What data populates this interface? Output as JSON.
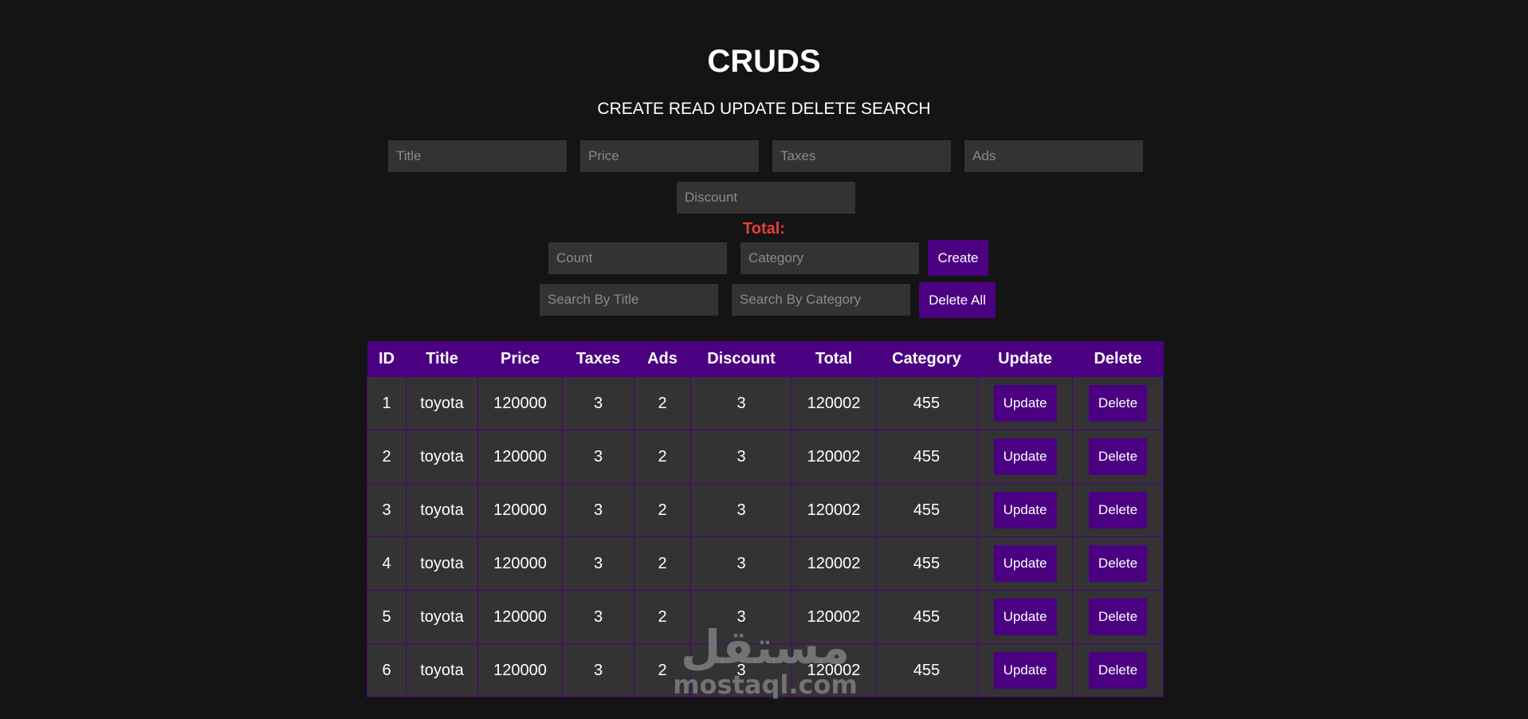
{
  "header": {
    "title": "CRUDS",
    "subtitle": "CREATE READ UPDATE DELETE SEARCH"
  },
  "form": {
    "title_placeholder": "Title",
    "price_placeholder": "Price",
    "taxes_placeholder": "Taxes",
    "ads_placeholder": "Ads",
    "discount_placeholder": "Discount",
    "total_label": "Total:",
    "count_placeholder": "Count",
    "category_placeholder": "Category",
    "create_label": "Create"
  },
  "search": {
    "title_placeholder": "Search By Title",
    "category_placeholder": "Search By Category",
    "delete_all_label": "Delete All"
  },
  "table": {
    "headers": {
      "id": "ID",
      "title": "Title",
      "price": "Price",
      "taxes": "Taxes",
      "ads": "Ads",
      "discount": "Discount",
      "total": "Total",
      "category": "Category",
      "update": "Update",
      "delete": "Delete"
    },
    "rows": [
      {
        "id": "1",
        "title": "toyota",
        "price": "120000",
        "taxes": "3",
        "ads": "2",
        "discount": "3",
        "total": "120002",
        "category": "455",
        "update_label": "Update",
        "delete_label": "Delete"
      },
      {
        "id": "2",
        "title": "toyota",
        "price": "120000",
        "taxes": "3",
        "ads": "2",
        "discount": "3",
        "total": "120002",
        "category": "455",
        "update_label": "Update",
        "delete_label": "Delete"
      },
      {
        "id": "3",
        "title": "toyota",
        "price": "120000",
        "taxes": "3",
        "ads": "2",
        "discount": "3",
        "total": "120002",
        "category": "455",
        "update_label": "Update",
        "delete_label": "Delete"
      },
      {
        "id": "4",
        "title": "toyota",
        "price": "120000",
        "taxes": "3",
        "ads": "2",
        "discount": "3",
        "total": "120002",
        "category": "455",
        "update_label": "Update",
        "delete_label": "Delete"
      },
      {
        "id": "5",
        "title": "toyota",
        "price": "120000",
        "taxes": "3",
        "ads": "2",
        "discount": "3",
        "total": "120002",
        "category": "455",
        "update_label": "Update",
        "delete_label": "Delete"
      },
      {
        "id": "6",
        "title": "toyota",
        "price": "120000",
        "taxes": "3",
        "ads": "2",
        "discount": "3",
        "total": "120002",
        "category": "455",
        "update_label": "Update",
        "delete_label": "Delete"
      }
    ]
  },
  "watermark": {
    "arabic_text": "مستقل",
    "url_text": "mostaql.com"
  },
  "colors": {
    "background": "#141414",
    "accent": "#4b0082",
    "input_bg": "#333333",
    "total_label": "#e8403a"
  }
}
